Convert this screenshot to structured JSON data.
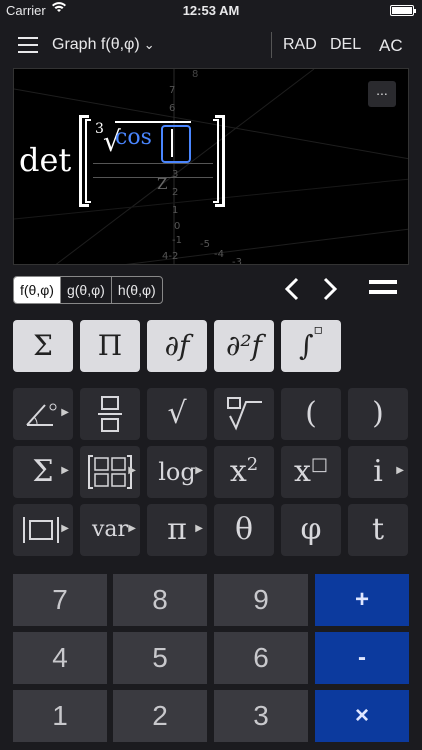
{
  "status_bar": {
    "carrier": "Carrier",
    "time": "12:53 AM"
  },
  "toolbar": {
    "title": "Graph f(θ,φ)",
    "rad": "RAD",
    "del": "DEL",
    "ac": "AC"
  },
  "graph": {
    "more": "...",
    "expression": {
      "det": "det",
      "root_index": "3",
      "root_symbol": "√",
      "func": "cos",
      "z_label": "Z"
    },
    "axis_labels": [
      "7",
      "8",
      "6",
      "5",
      "4",
      "3",
      "2",
      "1",
      "0",
      "-1",
      "-2",
      "-3",
      "-4",
      "-5",
      "4-2"
    ]
  },
  "function_tabs": [
    {
      "label": "f(θ,φ)",
      "active": true
    },
    {
      "label": "g(θ,φ)",
      "active": false
    },
    {
      "label": "h(θ,φ)",
      "active": false
    }
  ],
  "light_keys": [
    "Σ",
    "Π",
    "∂f",
    "∂²f",
    "∫"
  ],
  "keys_row1": [
    "angle",
    "fraction",
    "√",
    "□√",
    "(",
    ")"
  ],
  "keys_row2": {
    "sum": "Σ",
    "matrix": "matrix",
    "log": "log",
    "x2": "x",
    "x2_sup": "2",
    "xn": "x",
    "xn_sup": "□",
    "i": "i"
  },
  "keys_row3": {
    "abs": "|□|",
    "var": "var",
    "pi": "π",
    "theta": "θ",
    "phi": "φ",
    "t": "t"
  },
  "numpad": {
    "row1": [
      "7",
      "8",
      "9"
    ],
    "row2": [
      "4",
      "5",
      "6"
    ],
    "row3": [
      "1",
      "2",
      "3"
    ],
    "ops": [
      "+",
      "-",
      "×"
    ]
  },
  "colors": {
    "accent": "#4a86ff",
    "op_blue": "#0c3a9e"
  }
}
